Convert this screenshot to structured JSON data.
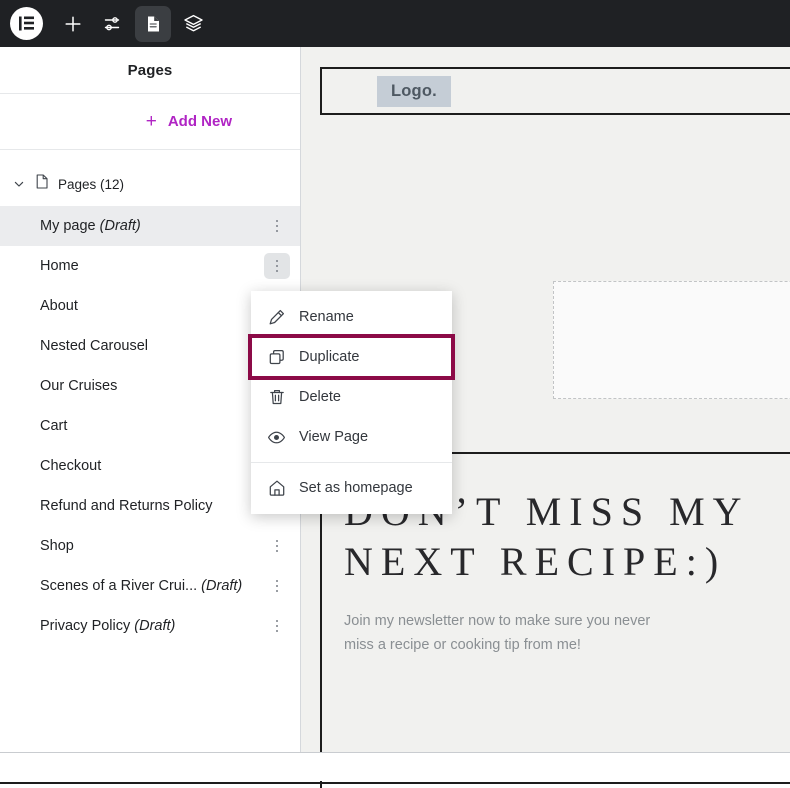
{
  "topbar": {
    "items": [
      {
        "name": "elementor-logo",
        "icon": "elementor-logo-icon",
        "active": false
      },
      {
        "name": "add-element-button",
        "icon": "plus-icon",
        "active": false
      },
      {
        "name": "site-settings-button",
        "icon": "sliders-icon",
        "active": false
      },
      {
        "name": "page-settings-button",
        "icon": "document-icon",
        "active": true
      },
      {
        "name": "structure-button",
        "icon": "layers-icon",
        "active": false
      }
    ]
  },
  "sidebar": {
    "title": "Pages",
    "add_new_label": "Add New",
    "group": {
      "label": "Pages (12)",
      "icon": "document-icon",
      "chevron": "chevron-down-icon"
    },
    "pages": [
      {
        "label": "My page",
        "suffix": "(Draft)",
        "selected": true,
        "menu_open": false
      },
      {
        "label": "Home",
        "suffix": "",
        "selected": false,
        "menu_open": true
      },
      {
        "label": "About",
        "suffix": "",
        "selected": false,
        "menu_open": false
      },
      {
        "label": "Nested Carousel",
        "suffix": "",
        "selected": false,
        "menu_open": false
      },
      {
        "label": "Our Cruises",
        "suffix": "",
        "selected": false,
        "menu_open": false
      },
      {
        "label": "Cart",
        "suffix": "",
        "selected": false,
        "menu_open": false
      },
      {
        "label": "Checkout",
        "suffix": "",
        "selected": false,
        "menu_open": false
      },
      {
        "label": "Refund and Returns Policy",
        "suffix": "",
        "selected": false,
        "menu_open": false
      },
      {
        "label": "Shop",
        "suffix": "",
        "selected": false,
        "menu_open": false
      },
      {
        "label": "Scenes of a River Crui...",
        "suffix": "(Draft)",
        "selected": false,
        "menu_open": false
      },
      {
        "label": "Privacy Policy",
        "suffix": "(Draft)",
        "selected": false,
        "menu_open": false
      }
    ]
  },
  "context_menu": {
    "items": [
      {
        "label": "Rename",
        "icon": "pencil-icon",
        "highlighted": false,
        "divider_after": false
      },
      {
        "label": "Duplicate",
        "icon": "copy-icon",
        "highlighted": true,
        "divider_after": false
      },
      {
        "label": "Delete",
        "icon": "trash-icon",
        "highlighted": false,
        "divider_after": false
      },
      {
        "label": "View Page",
        "icon": "eye-icon",
        "highlighted": false,
        "divider_after": true
      },
      {
        "label": "Set as homepage",
        "icon": "home-icon",
        "highlighted": false,
        "divider_after": false
      }
    ],
    "highlight_color": "#8c0a47"
  },
  "canvas": {
    "logo_text": "Logo.",
    "headline_line1": "DON’T MISS MY",
    "headline_line2": "NEXT RECIPE:)",
    "subcopy_line1": "Join my newsletter now to make sure you never",
    "subcopy_line2": "miss a recipe or cooking tip from me!"
  },
  "colors": {
    "accent": "#b024c4",
    "topbar_bg": "#1f2124",
    "canvas_bg": "#f1f1ef",
    "highlight": "#8c0a47",
    "logo_chip_bg": "#c5cdd6"
  }
}
